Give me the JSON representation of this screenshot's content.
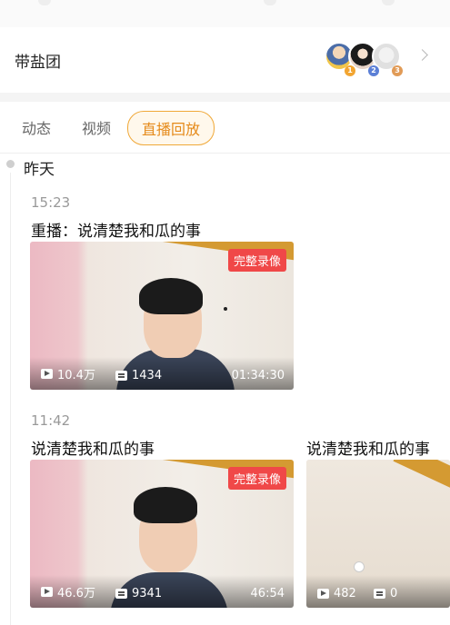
{
  "fan_group": {
    "title": "带盐团",
    "ranks": [
      "1",
      "2",
      "3"
    ]
  },
  "tabs": [
    "动态",
    "视频",
    "直播回放"
  ],
  "active_tab": "直播回放",
  "day_label": "昨天",
  "entries": [
    {
      "time": "15:23",
      "videos": [
        {
          "title": "重播：说清楚我和瓜的事",
          "badge": "完整录像",
          "plays": "10.4万",
          "comments": "1434",
          "duration": "01:34:30"
        }
      ]
    },
    {
      "time": "11:42",
      "videos": [
        {
          "title": "说清楚我和瓜的事",
          "badge": "完整录像",
          "plays": "46.6万",
          "comments": "9341",
          "duration": "46:54"
        },
        {
          "title": "说清楚我和瓜的事",
          "plays": "482",
          "comments": "0"
        }
      ]
    }
  ],
  "colors": {
    "accent": "#f0a838",
    "badge": "#f04848"
  },
  "icons": [
    "chevron-right-icon",
    "play-count-icon",
    "comment-count-icon"
  ]
}
